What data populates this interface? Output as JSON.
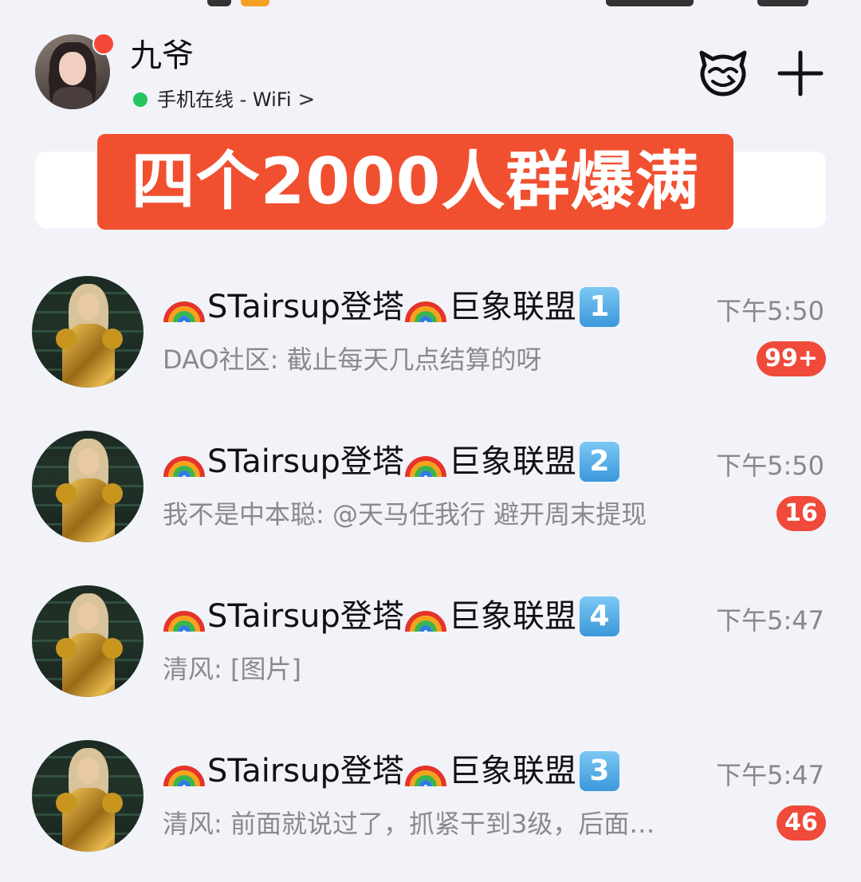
{
  "header": {
    "username": "九爷",
    "status_text": "手机在线 - WiFi",
    "status_chevron": ">",
    "status_color": "#22c55e"
  },
  "banner": {
    "text": "四个2000人群爆满",
    "color": "#f05030"
  },
  "conversations": [
    {
      "title": "STairsup登塔",
      "title_tail": "巨象联盟",
      "number": "1",
      "time": "下午5:50",
      "preview": "DAO社区: 截止每天几点结算的呀",
      "badge": "99+"
    },
    {
      "title": "STairsup登塔",
      "title_tail": "巨象联盟",
      "number": "2",
      "time": "下午5:50",
      "preview": "我不是中本聪: @天马任我行 避开周末提现",
      "badge": "16"
    },
    {
      "title": "STairsup登塔",
      "title_tail": "巨象联盟",
      "number": "4",
      "time": "下午5:47",
      "preview": "清风: [图片]",
      "badge": ""
    },
    {
      "title": "STairsup登塔",
      "title_tail": "巨象联盟",
      "number": "3",
      "time": "下午5:47",
      "preview": "清风: 前面就说过了，抓紧干到3级，后面…",
      "badge": "46"
    }
  ],
  "icons": {
    "header_right": [
      "mascot-icon",
      "plus-icon"
    ],
    "title_emoji": "rainbow-icon"
  },
  "colors": {
    "badge": "#f04a3a",
    "background": "#f1f3f9"
  }
}
